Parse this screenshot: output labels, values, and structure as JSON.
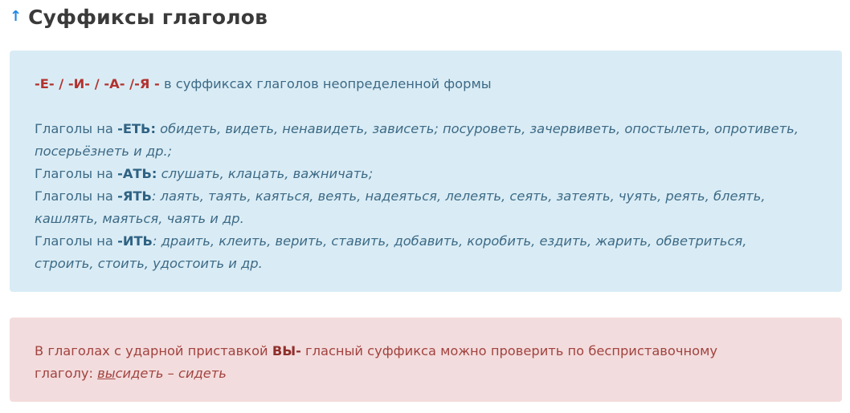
{
  "heading": {
    "title": "Суффиксы глаголов",
    "arrow": "↑"
  },
  "info_box": {
    "rule_markers": "-Е- / -И- / -А- /-Я -",
    "rule_text": " в суффиксах глаголов неопределенной формы",
    "groups": [
      {
        "prefix": "Глаголы на ",
        "ending": "-ЕТЬ:",
        "line1": " обидеть, видеть, ненавидеть, зависеть; посуроветь, зачервиветь, опостылеть, опротиветь,",
        "line2": "посерьёзнеть и др.;"
      },
      {
        "prefix": "Глаголы на ",
        "ending": "-АТЬ:",
        "line1": " слушать, клацать, важничать;"
      },
      {
        "prefix": "Глаголы на ",
        "ending": "-ЯТЬ",
        "line1": ": лаять, таять, каяться, веять, надеяться, лелеять, сеять, затеять, чуять, реять, блеять,",
        "line2": "кашлять, маяться, чаять и др."
      },
      {
        "prefix": "Глаголы на ",
        "ending": "-ИТЬ",
        "line1": ": драить, клеить, верить, ставить, добавить, коробить, ездить, жарить, обветриться,",
        "line2": "строить, стоить, удостоить и др."
      }
    ]
  },
  "warn_box": {
    "text_before": "В глаголах с ударной приставкой ",
    "prefix": "ВЫ-",
    "text_after": " гласный суффикса можно проверить по бесприставочному",
    "line2_start": "глаголу: ",
    "ex_prefix": "вы",
    "ex_rest": "сидеть – сидеть"
  },
  "colors": {
    "info_bg": "#d9ecf5",
    "info_text": "#3d6a86",
    "warn_bg": "#f3dcdd",
    "warn_text": "#a1433f",
    "accent_red": "#b3322e",
    "arrow_blue": "#1e88e5"
  }
}
